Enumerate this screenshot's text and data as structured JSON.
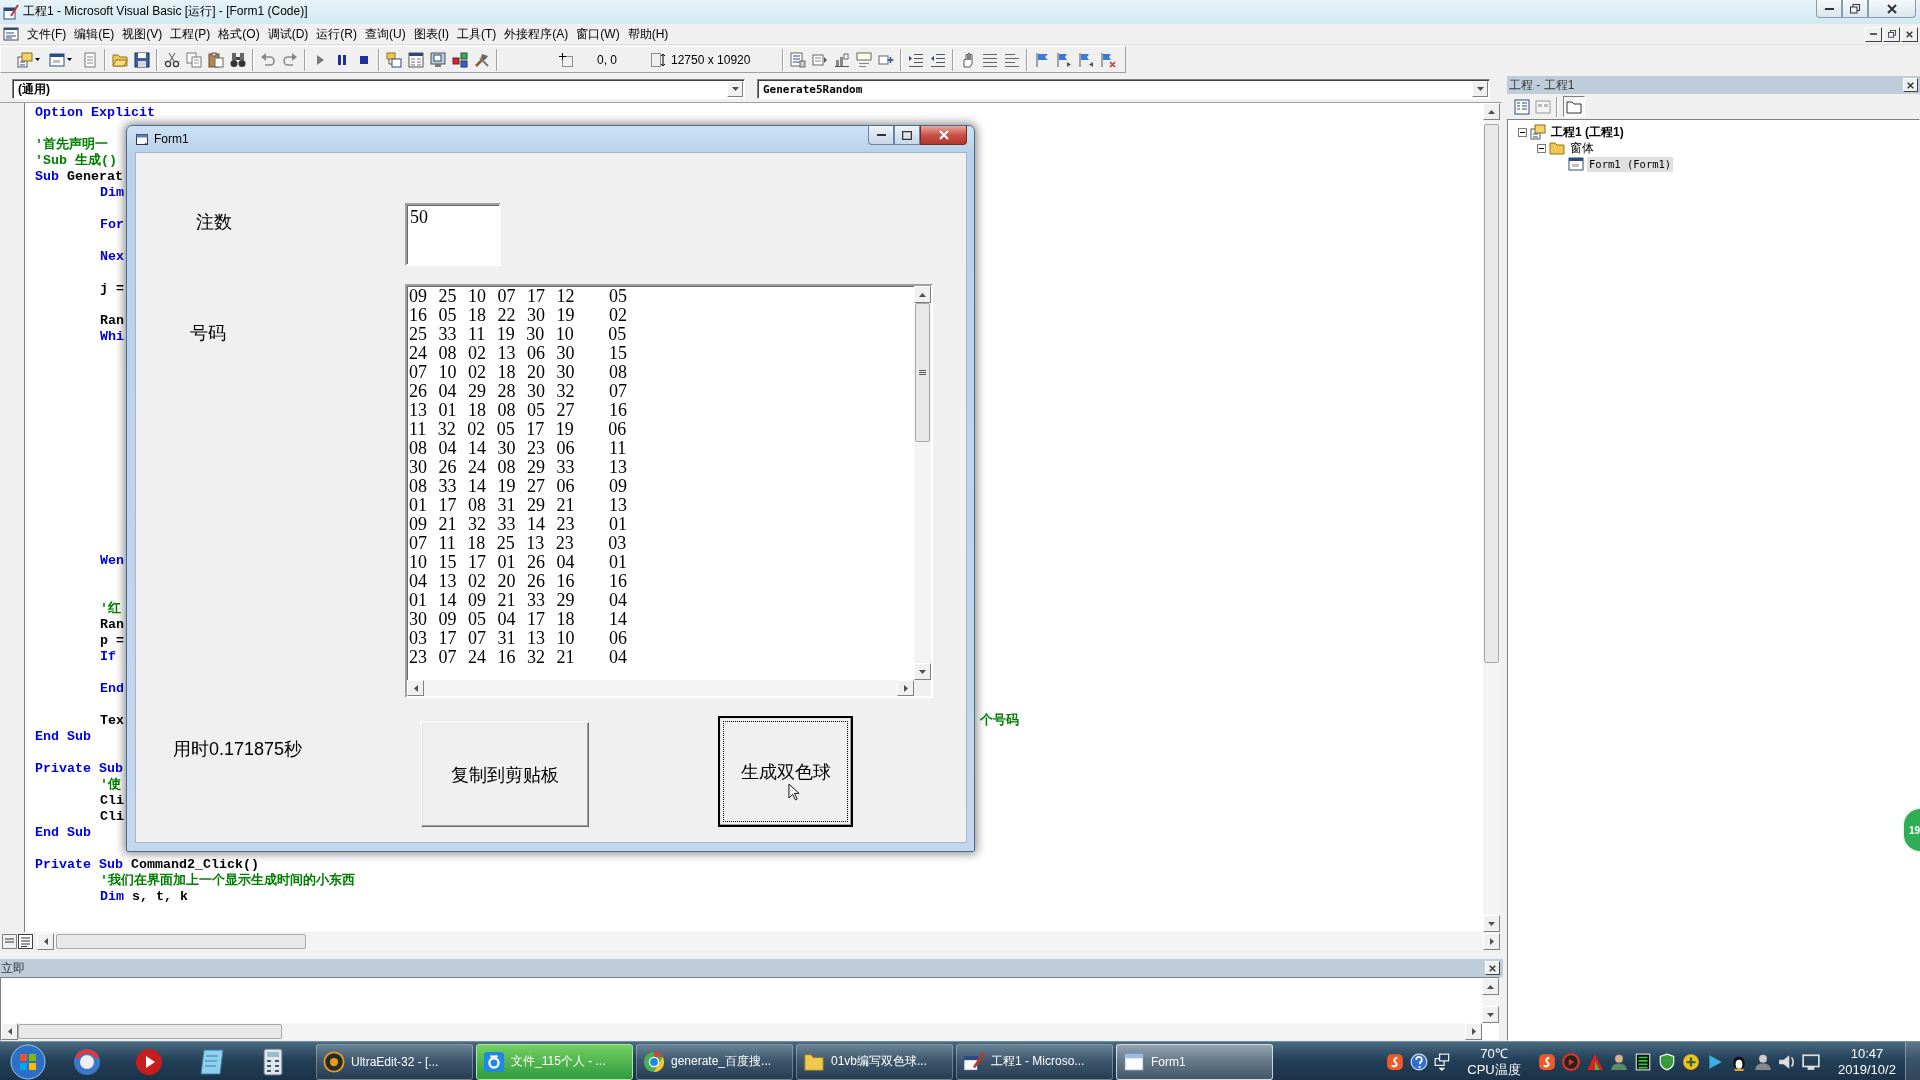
{
  "window": {
    "title": "工程1 - Microsoft Visual Basic [运行] - [Form1 (Code)]"
  },
  "menu_bar": {
    "items": [
      "文件(F)",
      "编辑(E)",
      "视图(V)",
      "工程(P)",
      "格式(O)",
      "调试(D)",
      "运行(R)",
      "查询(U)",
      "图表(I)",
      "工具(T)",
      "外接程序(A)",
      "窗口(W)",
      "帮助(H)"
    ]
  },
  "toolbar": {
    "position": "0, 0",
    "size": "12750 x 10920"
  },
  "code_window": {
    "object": "(通用)",
    "procedure": "Generate5Random",
    "lines": [
      {
        "kind": "code",
        "tokens": [
          {
            "kind": "keyword",
            "text": "Option Explicit"
          }
        ]
      },
      {
        "kind": "blank"
      },
      {
        "kind": "code",
        "tokens": [
          {
            "kind": "comment",
            "text": "'首先声明一"
          }
        ]
      },
      {
        "kind": "code",
        "tokens": [
          {
            "kind": "comment",
            "text": "'Sub 生成()"
          }
        ]
      },
      {
        "kind": "code",
        "tokens": [
          {
            "kind": "keyword",
            "text": "Sub"
          },
          {
            "kind": "plain",
            "text": "Generat"
          }
        ],
        "children": [
          {
            "kind": "code",
            "tokens": [
              {
                "kind": "keyword",
                "text": "Dim"
              }
            ]
          },
          {
            "kind": "blank"
          },
          {
            "kind": "code",
            "tokens": [
              {
                "kind": "keyword",
                "text": "For"
              }
            ]
          },
          {
            "kind": "blank"
          },
          {
            "kind": "code",
            "tokens": [
              {
                "kind": "keyword",
                "text": "Nex"
              }
            ]
          },
          {
            "kind": "blank"
          },
          {
            "kind": "code",
            "tokens": [
              {
                "kind": "plain",
                "text": "j ="
              }
            ]
          },
          {
            "kind": "blank"
          },
          {
            "kind": "code",
            "tokens": [
              {
                "kind": "plain",
                "text": "Ran"
              }
            ]
          },
          {
            "kind": "code",
            "tokens": [
              {
                "kind": "keyword",
                "text": "Whi"
              }
            ]
          },
          {
            "kind": "blank"
          },
          {
            "kind": "blank"
          },
          {
            "kind": "blank"
          },
          {
            "kind": "blank"
          },
          {
            "kind": "blank"
          },
          {
            "kind": "blank"
          },
          {
            "kind": "blank"
          },
          {
            "kind": "blank"
          },
          {
            "kind": "blank"
          },
          {
            "kind": "blank"
          },
          {
            "kind": "blank"
          },
          {
            "kind": "blank"
          },
          {
            "kind": "blank"
          },
          {
            "kind": "code",
            "tokens": [
              {
                "kind": "keyword",
                "text": "Wen"
              }
            ]
          },
          {
            "kind": "blank"
          },
          {
            "kind": "blank"
          },
          {
            "kind": "code",
            "tokens": [
              {
                "kind": "comment",
                "text": "'红"
              }
            ]
          },
          {
            "kind": "code",
            "tokens": [
              {
                "kind": "plain",
                "text": "Ran"
              }
            ]
          },
          {
            "kind": "code",
            "tokens": [
              {
                "kind": "plain",
                "text": "p ="
              }
            ]
          },
          {
            "kind": "code",
            "tokens": [
              {
                "kind": "keyword",
                "text": "If"
              }
            ]
          },
          {
            "kind": "blank"
          },
          {
            "kind": "code",
            "tokens": [
              {
                "kind": "keyword",
                "text": "End"
              }
            ]
          },
          {
            "kind": "blank"
          },
          {
            "kind": "code",
            "tokens": [
              {
                "kind": "plain",
                "text": "Tex"
              }
            ],
            "right_part": {
              "kind": "comment",
              "text": "个号码"
            }
          }
        ]
      },
      {
        "kind": "code",
        "tokens": [
          {
            "kind": "keyword",
            "text": "End Sub"
          }
        ]
      },
      {
        "kind": "blank"
      },
      {
        "kind": "code",
        "tokens": [
          {
            "kind": "keyword",
            "text": "Private Sub"
          }
        ],
        "children": [
          {
            "kind": "code",
            "tokens": [
              {
                "kind": "comment",
                "text": "'使"
              }
            ]
          },
          {
            "kind": "code",
            "tokens": [
              {
                "kind": "plain",
                "text": "Cli"
              }
            ]
          },
          {
            "kind": "code",
            "tokens": [
              {
                "kind": "plain",
                "text": "Cli"
              }
            ]
          }
        ]
      },
      {
        "kind": "code",
        "tokens": [
          {
            "kind": "keyword",
            "text": "End Sub"
          }
        ]
      },
      {
        "kind": "blank"
      },
      {
        "kind": "code",
        "tokens": [
          {
            "kind": "keyword",
            "text": "Private Sub"
          },
          {
            "kind": "plain",
            "text": "Command2_Click()"
          }
        ],
        "children": [
          {
            "kind": "code",
            "tokens": [
              {
                "kind": "comment",
                "text": "'我们在界面加上一个显示生成时间的小东西"
              }
            ]
          },
          {
            "kind": "code",
            "tokens": [
              {
                "kind": "keyword",
                "text": "Dim"
              },
              {
                "kind": "plain",
                "text": "s, t, k"
              }
            ]
          }
        ]
      }
    ]
  },
  "immediate_window": {
    "title": "立即"
  },
  "project_explorer": {
    "title": "工程 - 工程1",
    "tree": [
      {
        "kind": "project",
        "label": "工程1 (工程1)",
        "expanded": true,
        "selected": false,
        "children": [
          {
            "kind": "folder",
            "label": "窗体",
            "expanded": true,
            "selected": false,
            "children": [
              {
                "kind": "form",
                "label": "Form1 (Form1)",
                "selected": true
              }
            ]
          }
        ]
      }
    ]
  },
  "form_window": {
    "title": "Form1",
    "count_label": "注数",
    "count_value": "50",
    "numbers_label": "号码",
    "numbers": [
      "09 25 10 07 17 12   05",
      "16 05 18 22 30 19   02",
      "25 33 11 19 30 10   05",
      "24 08 02 13 06 30   15",
      "07 10 02 18 20 30   08",
      "26 04 29 28 30 32   07",
      "13 01 18 08 05 27   16",
      "11 32 02 05 17 19   06",
      "08 04 14 30 23 06   11",
      "30 26 24 08 29 33   13",
      "08 33 14 19 27 06   09",
      "01 17 08 31 29 21   13",
      "09 21 32 33 14 23   01",
      "07 11 18 25 13 23   03",
      "10 15 17 01 26 04   01",
      "04 13 02 20 26 16   16",
      "01 14 09 21 33 29   04",
      "30 09 05 04 17 18   14",
      "03 17 07 31 13 10   06",
      "23 07 24 16 32 21   04"
    ],
    "time_label": "用时0.171875秒",
    "buttons": [
      {
        "label": "复制到剪贴板",
        "focused": false
      },
      {
        "label": "生成双色球",
        "focused": true
      }
    ]
  },
  "side_ball": {
    "text": "19"
  },
  "taskbar": {
    "tasks": [
      {
        "kind": "editor",
        "label": "UltraEdit-32 - [...",
        "selected": false,
        "flashing": false
      },
      {
        "kind": "cloud",
        "label": "文件_115个人 - ...",
        "selected": false,
        "flashing": true
      },
      {
        "kind": "browser",
        "label": "generate_百度搜...",
        "selected": false,
        "flashing": false
      },
      {
        "kind": "folder",
        "label": "01vb编写双色球...",
        "selected": false,
        "flashing": false
      },
      {
        "kind": "vb",
        "label": "工程1 - Microso...",
        "selected": false,
        "flashing": false
      },
      {
        "kind": "window",
        "label": "Form1",
        "selected": true,
        "flashing": false
      }
    ],
    "cpu_temp": "70℃",
    "cpu_label": "CPU温度",
    "time": "10:47",
    "date": "2019/10/2"
  }
}
